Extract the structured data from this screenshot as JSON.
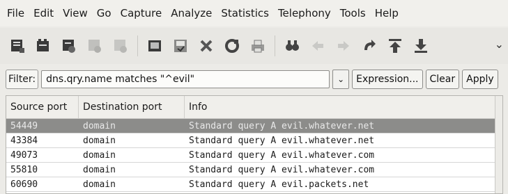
{
  "menubar": {
    "items": [
      "File",
      "Edit",
      "View",
      "Go",
      "Capture",
      "Analyze",
      "Statistics",
      "Telephony",
      "Tools",
      "Help"
    ]
  },
  "toolbar": {
    "icons": [
      "interface-list-icon",
      "capture-options-icon",
      "start-capture-icon",
      "stop-capture-icon",
      "restart-capture-icon",
      "open-file-icon",
      "save-file-icon",
      "close-file-icon",
      "reload-icon",
      "print-icon",
      "find-packet-icon",
      "go-back-icon",
      "go-forward-icon",
      "go-to-packet-icon",
      "go-first-icon",
      "go-last-icon"
    ],
    "overflow": "⌄"
  },
  "filter": {
    "label": "Filter:",
    "value": "dns.qry.name matches \"^evil\"",
    "combo_arrow": "⌄",
    "expression_label": "Expression...",
    "clear_label": "Clear",
    "apply_label": "Apply"
  },
  "packet_list": {
    "columns": [
      "Source port",
      "Destination port",
      "Info"
    ],
    "rows": [
      {
        "source_port": "54449",
        "destination_port": "domain",
        "info": "Standard query A evil.whatever.net",
        "selected": true
      },
      {
        "source_port": "43384",
        "destination_port": "domain",
        "info": "Standard query A evil.whatever.net",
        "selected": false
      },
      {
        "source_port": "49073",
        "destination_port": "domain",
        "info": "Standard query A evil.whatever.com",
        "selected": false
      },
      {
        "source_port": "55810",
        "destination_port": "domain",
        "info": "Standard query A evil.whatever.com",
        "selected": false
      },
      {
        "source_port": "60690",
        "destination_port": "domain",
        "info": "Standard query A evil.packets.net",
        "selected": false
      }
    ]
  },
  "colors": {
    "selected_row": "#8c8c8a",
    "toolbar_dark": "#3a3a3a",
    "toolbar_disabled": "#b8b8b5"
  }
}
